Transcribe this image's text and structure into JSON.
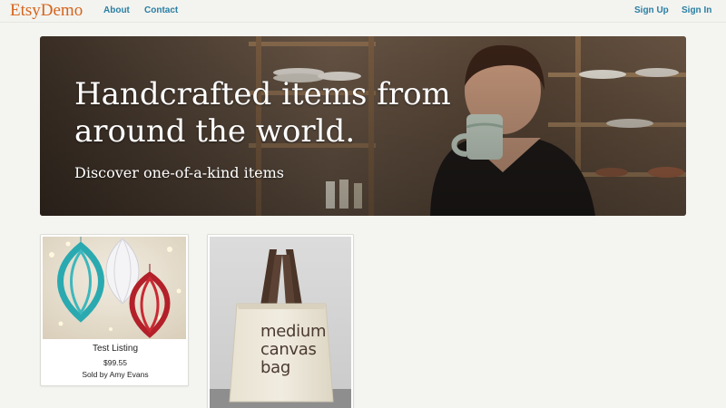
{
  "navbar": {
    "brand": "EtsyDemo",
    "links": [
      "About",
      "Contact"
    ],
    "auth": {
      "signup": "Sign Up",
      "signin": "Sign In"
    }
  },
  "hero": {
    "title": "Handcrafted items from around the world.",
    "subtitle": "Discover one-of-a-kind items"
  },
  "listings": [
    {
      "title": "Test Listing",
      "price": "$99.55",
      "seller": "Sold by Amy Evans",
      "image": "paper-ornaments"
    },
    {
      "image": "tote-bag",
      "image_text": "medium canvas bag"
    }
  ],
  "colors": {
    "brand": "#d5641c",
    "link": "#2a7fa3",
    "background": "#f4f4f0"
  }
}
